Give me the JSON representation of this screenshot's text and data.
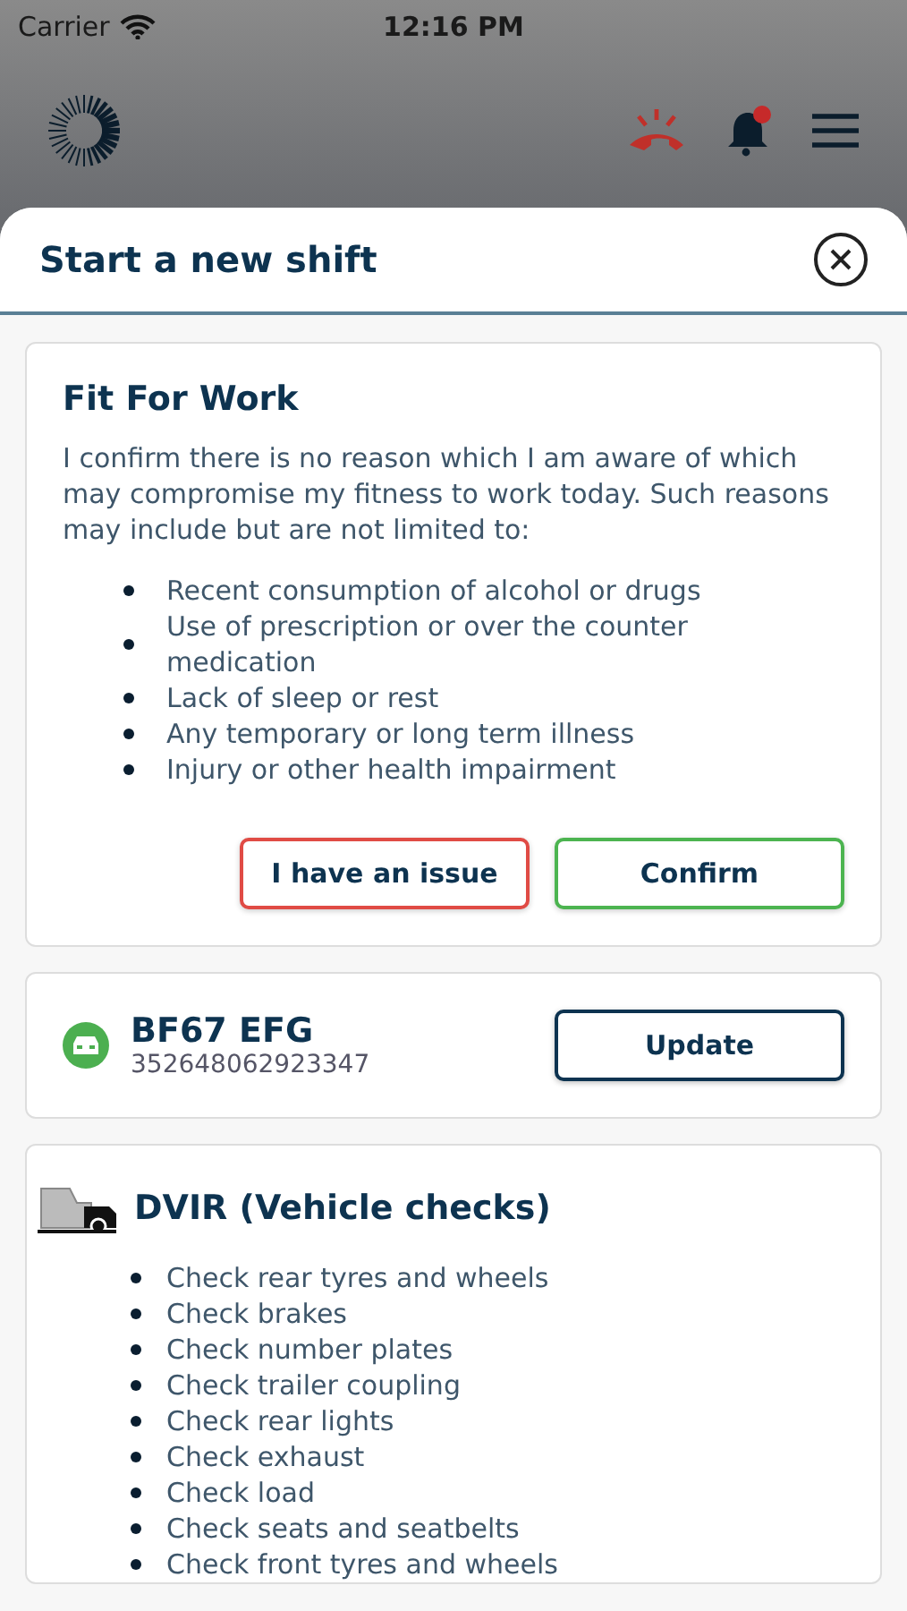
{
  "status_bar": {
    "carrier": "Carrier",
    "time": "12:16 PM"
  },
  "sheet": {
    "title": "Start a new shift"
  },
  "fit_for_work": {
    "title": "Fit For Work",
    "intro": "I confirm there is no reason which I am aware of which may compromise my fitness to work today. Such reasons may include but are not limited to:",
    "reasons": [
      "Recent consumption of alcohol or drugs",
      "Use of prescription or over the counter medication",
      "Lack of sleep or rest",
      "Any temporary or long term illness",
      "Injury or other health impairment"
    ],
    "buttons": [
      {
        "label": "I have an issue",
        "kind": "issue"
      },
      {
        "label": "Confirm",
        "kind": "confirm"
      }
    ]
  },
  "vehicle": {
    "registration": "BF67 EFG",
    "number": "352648062923347",
    "color": "#4caf50",
    "button": "Update"
  },
  "dvir": {
    "title": "DVIR (Vehicle checks)",
    "checks": [
      "Check rear tyres and wheels",
      "Check brakes",
      "Check number plates",
      "Check trailer coupling",
      "Check rear lights",
      "Check exhaust",
      "Check load",
      "Check seats and seatbelts",
      "Check front tyres and wheels"
    ]
  }
}
